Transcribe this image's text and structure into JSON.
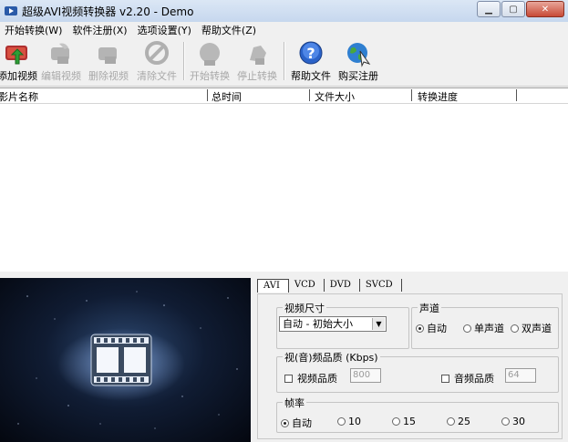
{
  "window": {
    "title": "超级AVI视频转换器 v2.20 - Demo"
  },
  "menu": [
    "开始转换(W)",
    "软件注册(X)",
    "选项设置(Y)",
    "帮助文件(Z)"
  ],
  "toolbar": {
    "add": "添加视频",
    "edit": "编辑视频",
    "delete": "删除视频",
    "clear": "清除文件",
    "start": "开始转换",
    "stop": "停止转换",
    "help": "帮助文件",
    "buy": "购买注册"
  },
  "list": {
    "columns": [
      "影片名称",
      "总时间",
      "文件大小",
      "转换进度"
    ]
  },
  "tabs": [
    "AVI",
    "VCD",
    "DVD",
    "SVCD"
  ],
  "video_size": {
    "label": "视频尺寸",
    "value": "自动 - 初始大小"
  },
  "audio_channel": {
    "label": "声道",
    "options": [
      "自动",
      "单声道",
      "双声道"
    ],
    "selected": 0
  },
  "quality": {
    "label": "视(音)频品质 (Kbps)",
    "video_label": "视频品质",
    "video_value": "800",
    "audio_label": "音频品质",
    "audio_value": "64"
  },
  "framerate": {
    "label": "帧率",
    "options": [
      "自动",
      "10",
      "15",
      "25",
      "30"
    ],
    "selected": 0
  }
}
